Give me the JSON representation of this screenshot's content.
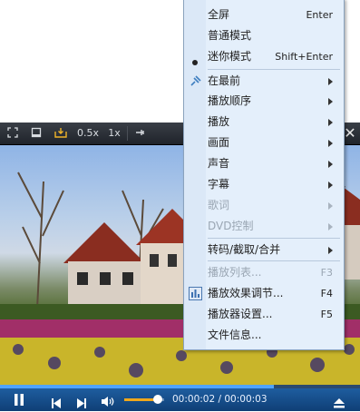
{
  "toolbar": {
    "speed_half": "0.5x",
    "speed_one": "1x"
  },
  "controls": {
    "time": "00:00:02 / 00:00:03",
    "progress": 0.76,
    "volume": 0.85
  },
  "menu": {
    "items": [
      {
        "label": "全屏",
        "shortcut": "Enter"
      },
      {
        "label": "普通模式",
        "shortcut": ""
      },
      {
        "label": "迷你模式",
        "shortcut": "Shift+Enter"
      },
      {
        "label": "在最前",
        "shortcut": ""
      },
      {
        "label": "播放顺序",
        "shortcut": ""
      },
      {
        "label": "播放",
        "shortcut": ""
      },
      {
        "label": "画面",
        "shortcut": ""
      },
      {
        "label": "声音",
        "shortcut": ""
      },
      {
        "label": "字幕",
        "shortcut": ""
      },
      {
        "label": "歌词",
        "shortcut": ""
      },
      {
        "label": "DVD控制",
        "shortcut": ""
      },
      {
        "label": "转码/截取/合并",
        "shortcut": ""
      },
      {
        "label": "播放列表...",
        "shortcut": "F3"
      },
      {
        "label": "播放效果调节...",
        "shortcut": "F4"
      },
      {
        "label": "播放器设置...",
        "shortcut": "F5"
      },
      {
        "label": "文件信息...",
        "shortcut": ""
      }
    ]
  }
}
